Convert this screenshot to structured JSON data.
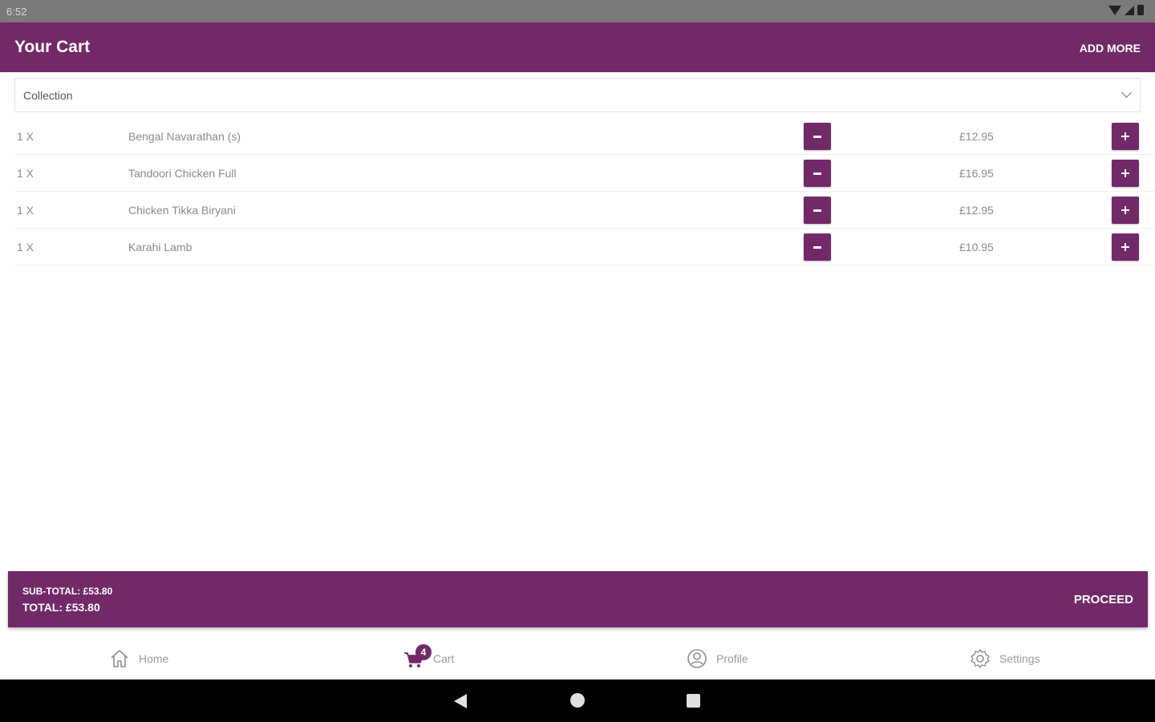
{
  "status_bar": {
    "time": "6:52",
    "icons": [
      "wifi-icon",
      "signal-icon",
      "battery-icon"
    ]
  },
  "app_bar": {
    "title": "Your Cart",
    "action_label": "ADD MORE"
  },
  "order_type": {
    "selected": "Collection"
  },
  "cart_items": [
    {
      "qty": "1 X",
      "name": "Bengal Navarathan (s)",
      "price": "£12.95"
    },
    {
      "qty": "1 X",
      "name": "Tandoori Chicken Full",
      "price": "£16.95"
    },
    {
      "qty": "1 X",
      "name": "Chicken Tikka Biryani",
      "price": "£12.95"
    },
    {
      "qty": "1 X",
      "name": "Karahi Lamb",
      "price": "£10.95"
    }
  ],
  "summary": {
    "subtotal": "SUB-TOTAL: £53.80",
    "total": "TOTAL: £53.80",
    "proceed_label": "PROCEED"
  },
  "bottom_nav": {
    "home": {
      "label": "Home",
      "icon": "home-icon"
    },
    "cart": {
      "label": "Cart",
      "icon": "cart-icon",
      "badge": "4"
    },
    "profile": {
      "label": "Profile",
      "icon": "profile-icon"
    },
    "settings": {
      "label": "Settings",
      "icon": "gear-icon"
    }
  },
  "colors": {
    "primary": "#722968",
    "text_muted": "#8a8a8a",
    "nav_label": "#9b9b9b"
  }
}
